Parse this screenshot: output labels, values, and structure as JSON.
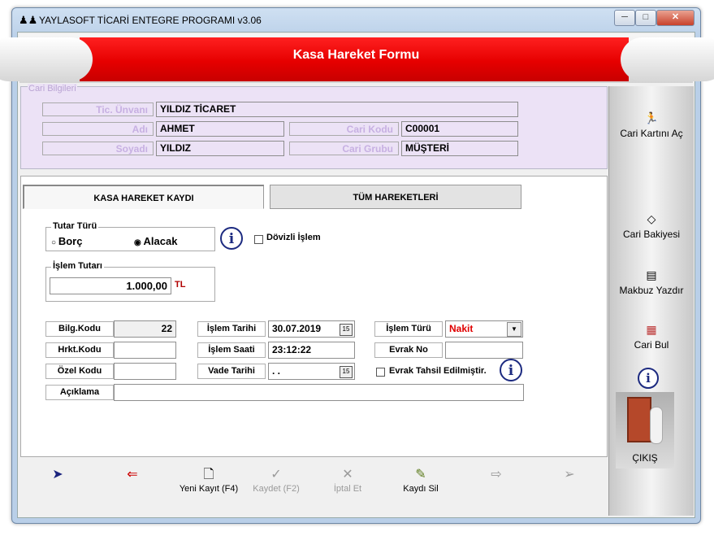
{
  "window": {
    "title": "YAYLASOFT TİCARİ ENTEGRE PROGRAMI v3.06",
    "minimize": "─",
    "maximize": "□",
    "close": "✕"
  },
  "header": {
    "title": "Kasa Hareket Formu"
  },
  "cari": {
    "legend": "Cari Bilgileri",
    "unvan_label": "Tic. Ünvanı",
    "unvan": "YILDIZ TİCARET",
    "adi_label": "Adı",
    "adi": "AHMET",
    "soyadi_label": "Soyadı",
    "soyadi": "YILDIZ",
    "kod_label": "Cari Kodu",
    "kod": "C00001",
    "grup_label": "Cari Grubu",
    "grup": "MÜŞTERİ"
  },
  "tabs": [
    {
      "label": "KASA HAREKET KAYDI",
      "active": true
    },
    {
      "label": "TÜM HAREKETLERİ",
      "active": false
    }
  ],
  "form": {
    "tutar_turu": {
      "legend": "Tutar Türü",
      "borc": "Borç",
      "alacak": "Alacak",
      "selected": "Alacak"
    },
    "dovizli": {
      "label": "Dövizli İşlem",
      "checked": false
    },
    "tutar": {
      "legend": "İşlem Tutarı",
      "value": "1.000,00",
      "currency": "TL"
    },
    "bilg_kodu_label": "Bilg.Kodu",
    "bilg_kodu": "22",
    "hrkt_kodu_label": "Hrkt.Kodu",
    "hrkt_kodu": "",
    "ozel_kodu_label": "Özel Kodu",
    "ozel_kodu": "",
    "aciklama_label": "Açıklama",
    "aciklama": "",
    "islem_tarihi_label": "İşlem Tarihi",
    "islem_tarihi": "30.07.2019",
    "islem_saati_label": "İşlem Saati",
    "islem_saati": "23:12:22",
    "vade_tarihi_label": "Vade Tarihi",
    "vade_tarihi": ". .",
    "islem_turu_label": "İşlem Türü",
    "islem_turu": "Nakit",
    "islem_turu_color": "#e00000",
    "evrak_no_label": "Evrak No",
    "evrak_no": "",
    "evrak_tahsil": {
      "label": "Evrak Tahsil Edilmiştir.",
      "checked": false
    },
    "calendar_glyph": "15"
  },
  "right_panel": {
    "cari_karti": "Cari Kartını Aç",
    "cari_bakiyesi": "Cari Bakiyesi",
    "makbuz": "Makbuz Yazdır",
    "cari_bul": "Cari Bul",
    "cikis": "ÇIKIŞ"
  },
  "toolbar": {
    "yeni": "Yeni Kayıt (F4)",
    "kaydet": "Kaydet (F2)",
    "iptal": "İptal Et",
    "sil": "Kaydı Sil"
  }
}
